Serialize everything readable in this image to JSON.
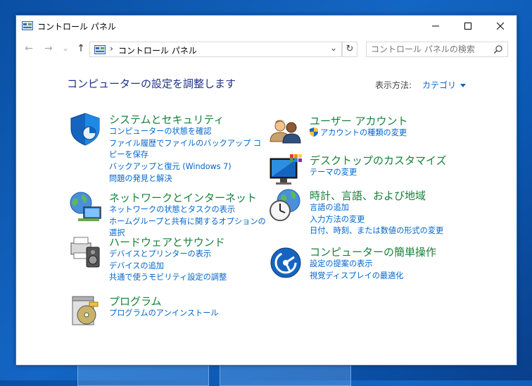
{
  "window": {
    "title": "コントロール パネル"
  },
  "nav": {
    "back": "←",
    "forward": "→",
    "recent": "⌄",
    "up": "↑",
    "breadcrumb_sep": "›",
    "path": "コントロール パネル",
    "dropdown": "⌄",
    "refresh": "↻"
  },
  "search": {
    "placeholder": "コントロール パネルの検索",
    "value": ""
  },
  "main": {
    "heading": "コンピューターの設定を調整します",
    "view_by_label": "表示方法:",
    "view_by_value": "カテゴリ"
  },
  "categories": [
    {
      "title": "システムとセキュリティ",
      "icon": "shield-icon",
      "links": [
        "コンピューターの状態を確認",
        "ファイル履歴でファイルのバックアップ コピーを保存",
        "バックアップと復元 (Windows 7)",
        "問題の発見と解決"
      ]
    },
    {
      "title": "ネットワークとインターネット",
      "icon": "network-globe-icon",
      "links": [
        "ネットワークの状態とタスクの表示",
        "ホームグループと共有に関するオプションの選択"
      ]
    },
    {
      "title": "ハードウェアとサウンド",
      "icon": "printer-speaker-icon",
      "links": [
        "デバイスとプリンターの表示",
        "デバイスの追加",
        "共通で使うモビリティ設定の調整"
      ]
    },
    {
      "title": "プログラム",
      "icon": "program-disc-icon",
      "links": [
        "プログラムのアンインストール"
      ]
    },
    {
      "title": "ユーザー アカウント",
      "icon": "users-icon",
      "links": [
        "アカウントの種類の変更"
      ]
    },
    {
      "title": "デスクトップのカスタマイズ",
      "icon": "desktop-monitor-icon",
      "links": [
        "テーマの変更"
      ]
    },
    {
      "title": "時計、言語、および地域",
      "icon": "clock-globe-icon",
      "links": [
        "言語の追加",
        "入力方法の変更",
        "日付、時刻、または数値の形式の変更"
      ]
    },
    {
      "title": "コンピューターの簡単操作",
      "icon": "ease-of-access-icon",
      "links": [
        "設定の提案の表示",
        "視覚ディスプレイの最適化"
      ]
    }
  ],
  "colors": {
    "title_green": "#17813a",
    "link_blue": "#0066cc",
    "heading_navy": "#1e3287",
    "desktop_blue": "#1466c4"
  }
}
